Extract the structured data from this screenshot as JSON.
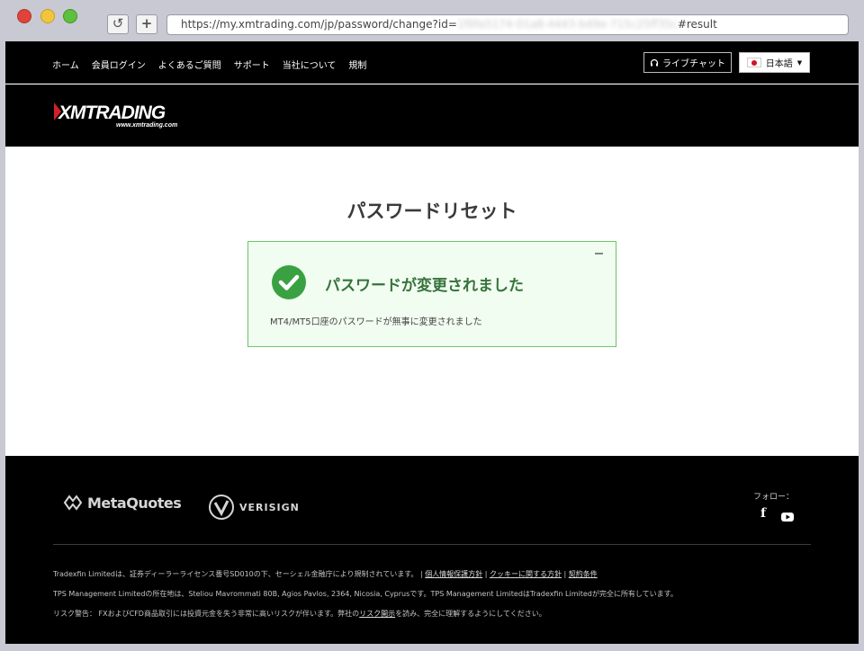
{
  "browser": {
    "url_prefix": "https://my.xmtrading.com/jp/password/change?id=",
    "url_hidden": "1f0fa5174-01a8-4443-b49e-715c25ff35c",
    "url_suffix": "#result",
    "reload_icon": "reload-icon",
    "new_tab_label": "+"
  },
  "nav": {
    "items": [
      "ホーム",
      "会員ログイン",
      "よくあるご質問",
      "サポート",
      "当社について",
      "規制"
    ]
  },
  "header": {
    "live_chat_label": "ライブチャット",
    "language_label": "日本語"
  },
  "logo": {
    "name": "XMTRADING",
    "url": "www.xmtrading.com"
  },
  "main": {
    "title": "パスワードリセット",
    "alert": {
      "title": "パスワードが変更されました",
      "message": "MT4/MT5口座のパスワードが無事に変更されました"
    }
  },
  "footer": {
    "partners": [
      "MetaQuotes",
      "VERISIGN"
    ],
    "follow_label": "フォロー：",
    "line1_text": "Tradexfin Limitedは、証券ディーラーライセンス番号SD010の下、セーシェル金融庁により規制されています。 | ",
    "line1_link1": "個人情報保護方針",
    "line1_sep": " | ",
    "line1_link2": "クッキーに関する方針",
    "line1_link3": "契約条件",
    "line2": "TPS Management Limitedの所在地は、Steliou Mavrommati 80B, Agios Pavlos, 2364, Nicosia, Cyprusです。TPS Management LimitedはTradexfin Limitedが完全に所有しています。",
    "line3_prefix": "リスク警告： FXおよびCFD商品取引には投資元金を失う非常に高いリスクが伴います。弊社の",
    "line3_link": "リスク開示",
    "line3_suffix": "を読み、完全に理解するようにしてください。"
  },
  "colors": {
    "success_green": "#3aa142",
    "alert_border": "#6fc36a",
    "alert_bg": "#f1fdf1",
    "header_bg": "#000000",
    "brand_red": "#d51f26"
  }
}
